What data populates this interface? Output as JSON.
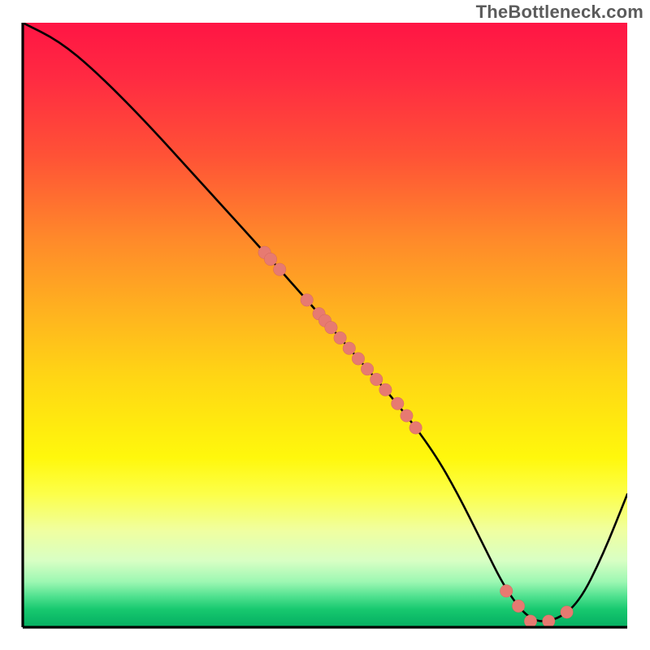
{
  "watermark": "TheBottleneck.com",
  "chart_data": {
    "type": "line",
    "title": "",
    "xlabel": "",
    "ylabel": "",
    "xlim": [
      0,
      100
    ],
    "ylim": [
      0,
      100
    ],
    "grid": false,
    "legend": false,
    "annotations": [],
    "series": [
      {
        "name": "curve",
        "x": [
          0,
          6,
          12,
          20,
          30,
          40,
          48,
          55,
          62,
          68,
          72,
          76,
          80,
          84,
          88,
          92,
          96,
          100
        ],
        "y": [
          100,
          97,
          92,
          84,
          73,
          62,
          53,
          45,
          37,
          29,
          22,
          14,
          6,
          1,
          1,
          4,
          12,
          22
        ]
      }
    ],
    "markers_on_curve_x": [
      40,
      41,
      42.5,
      47,
      49,
      50,
      51,
      52.5,
      54,
      55.5,
      57,
      58.5,
      60,
      62,
      63.5,
      65,
      80,
      82,
      84,
      87,
      90
    ]
  }
}
